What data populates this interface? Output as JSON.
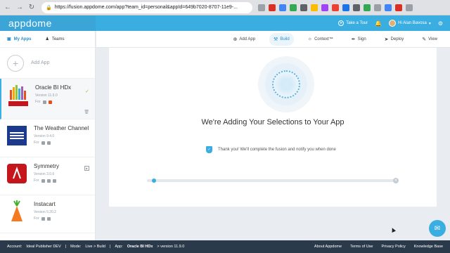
{
  "browser": {
    "url": "https://fusion.appdome.com/app?team_id=personal&appId=649b7020-8707-11e9-..."
  },
  "header": {
    "logo": "appdome",
    "take_tour": "Take a Tour",
    "user": "Hi Alan Bavosa"
  },
  "sidebar": {
    "tabs": [
      {
        "label": "My Apps"
      },
      {
        "label": "Teams"
      }
    ],
    "add_app": "Add App",
    "apps": [
      {
        "name": "Oracle BI HDx",
        "version": "Version 11.9.0",
        "for": "For"
      },
      {
        "name": "The Weather Channel",
        "version": "Version 9.4.0",
        "for": "For"
      },
      {
        "name": "Symmetry",
        "version": "Version 3.0.6",
        "for": "For"
      },
      {
        "name": "Instacart",
        "version": "Version 5.20.2",
        "for": "For"
      }
    ]
  },
  "toolbar": {
    "items": [
      {
        "label": "Add App"
      },
      {
        "label": "Build"
      },
      {
        "label": "Context™"
      },
      {
        "label": "Sign"
      },
      {
        "label": "Deploy"
      },
      {
        "label": "View"
      }
    ]
  },
  "main": {
    "heading": "We're Adding Your Selections to Your App",
    "notice": "Thank you! We'll complete the fusion and notify you when done"
  },
  "progress": {
    "value": 0.02
  },
  "statusbar": {
    "account_label": "Account:",
    "account": "Ideal Publisher DEV",
    "mode_label": "Mode:",
    "mode": "Live > Build",
    "app_label": "App:",
    "app": "Oracle BI HDx",
    "version": "> version 11.9.0",
    "links": [
      "About Appdome",
      "Terms of Use",
      "Privacy Policy",
      "Knowledge Base"
    ]
  },
  "colors": {
    "accent": "#3aaee0",
    "statusbar": "#2b3a4a"
  }
}
